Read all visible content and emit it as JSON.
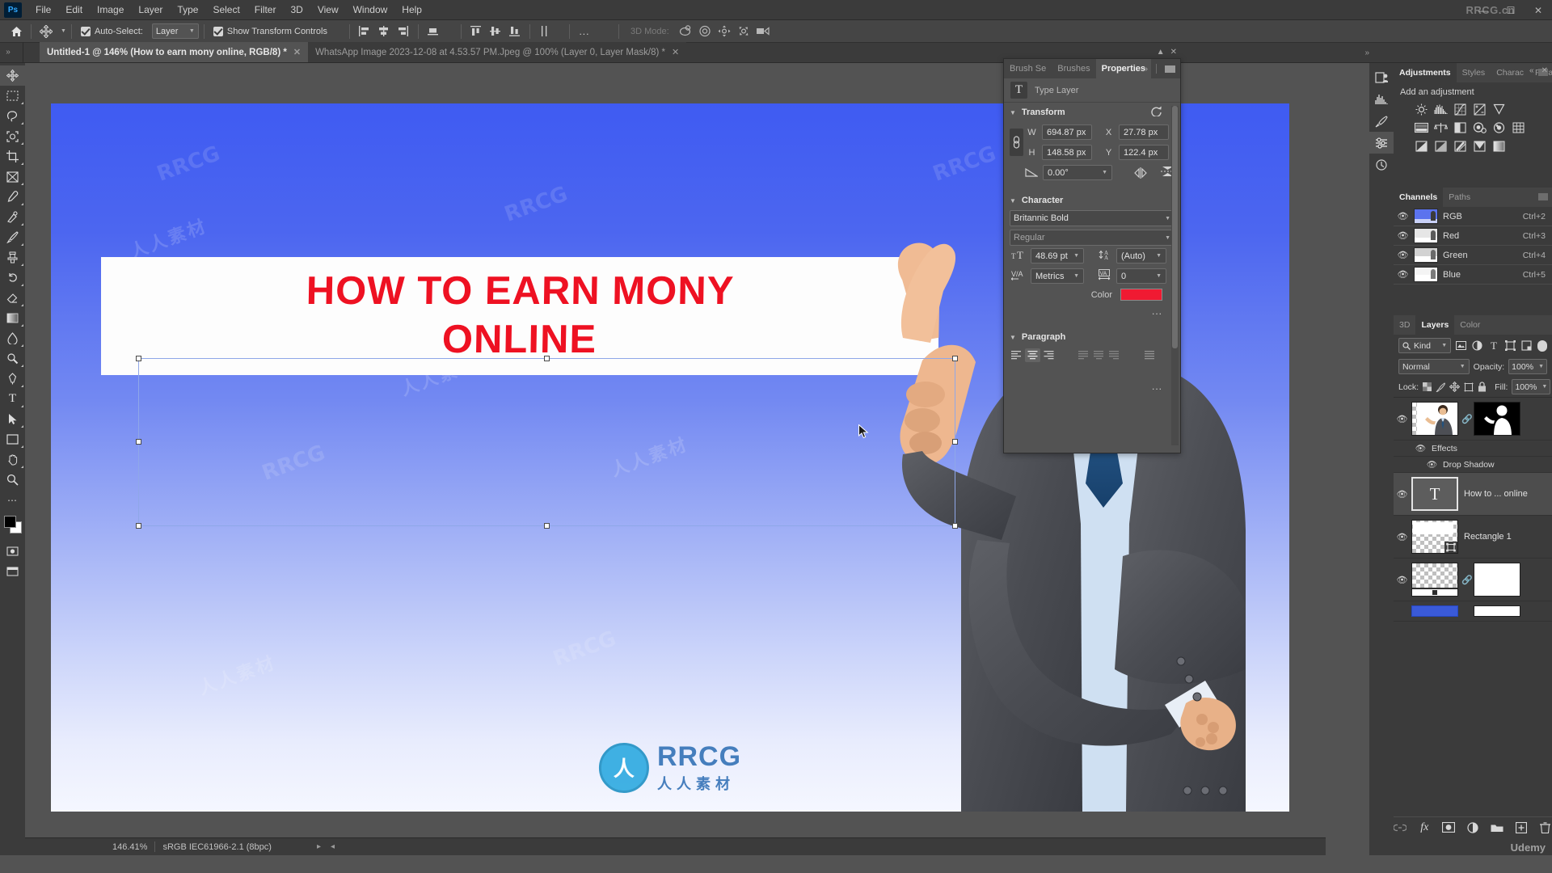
{
  "app": {
    "name": "Adobe Photoshop",
    "logo_text": "Ps",
    "watermark_brand": "RRCG.cn",
    "watermark_text": "RRCG",
    "watermark_cn": "人人素材",
    "udemy": "Udemy"
  },
  "menubar": {
    "items": [
      "File",
      "Edit",
      "Image",
      "Layer",
      "Type",
      "Select",
      "Filter",
      "3D",
      "View",
      "Window",
      "Help"
    ],
    "window_controls": [
      "minimize",
      "maximize",
      "close"
    ]
  },
  "optionsbar": {
    "home_icon": "home-icon",
    "tool_icon": "move-tool-icon",
    "auto_select_label": "Auto-Select:",
    "auto_select_checked": true,
    "auto_select_scope": "Layer",
    "show_transform_label": "Show Transform Controls",
    "show_transform_checked": true,
    "align_icons": [
      "align-left-edges",
      "align-horizontal-centers",
      "align-right-edges",
      "align-bottom-edges"
    ],
    "distribute_icons": [
      "distribute-top-edges",
      "distribute-vertical-centers",
      "distribute-bottom-edges",
      "distribute-horizontal-centers"
    ],
    "more_label": "...",
    "three_d_mode_label": "3D Mode:",
    "three_d_icons": [
      "orbit-3d-icon",
      "roll-3d-icon",
      "pan-3d-icon",
      "slide-3d-icon",
      "camera-3d-icon"
    ]
  },
  "tabs": [
    {
      "title": "Untitled-1 @ 146% (How to earn mony online, RGB/8) *",
      "active": true,
      "closable": true
    },
    {
      "title": "WhatsApp Image 2023-12-08 at 4.53.57 PM.Jpeg @ 100% (Layer 0, Layer Mask/8) *",
      "active": false,
      "closable": true
    }
  ],
  "toolbar": {
    "tools": [
      "move-tool",
      "rectangular-marquee-tool",
      "lasso-tool",
      "object-selection-tool",
      "crop-tool",
      "frame-tool",
      "eyedropper-tool",
      "spot-healing-brush-tool",
      "brush-tool",
      "clone-stamp-tool",
      "history-brush-tool",
      "eraser-tool",
      "gradient-tool",
      "blur-tool",
      "dodge-tool",
      "pen-tool",
      "horizontal-type-tool",
      "path-selection-tool",
      "rectangle-tool",
      "hand-tool",
      "zoom-tool",
      "edit-toolbar"
    ],
    "foreground_color": "#000000",
    "background_color": "#ffffff"
  },
  "canvas": {
    "headline_line1": "HOW TO EARN MONY",
    "headline_line2": "ONLINE",
    "headline_color": "#ee1122",
    "band_color": "#fdfdfd",
    "background_gradient_top": "#3f5bf2",
    "background_gradient_bottom": "#f5f7ff"
  },
  "statusbar": {
    "zoom": "146.41%",
    "color_profile": "sRGB IEC61966-2.1 (8bpc)"
  },
  "properties_panel": {
    "tabs": [
      {
        "label": "Brush Se",
        "active": false
      },
      {
        "label": "Brushes",
        "active": false
      },
      {
        "label": "Properties",
        "active": true
      }
    ],
    "menu_icons": [
      ">>",
      "panel-menu-icon"
    ],
    "layer_type_icon": "type-layer-icon",
    "layer_type_label": "Type Layer",
    "transform": {
      "section_label": "Transform",
      "reset_icon": "reset-icon",
      "link_icon": "link-aspect-ratio-icon",
      "w_label": "W",
      "w_value": "694.87 px",
      "h_label": "H",
      "h_value": "148.58 px",
      "x_label": "X",
      "x_value": "27.78 px",
      "y_label": "Y",
      "y_value": "122.4 px",
      "angle_icon": "rotate-angle-icon",
      "angle_value": "0.00°",
      "flip_h_icon": "flip-horizontal-icon",
      "flip_v_icon": "flip-vertical-icon"
    },
    "character": {
      "section_label": "Character",
      "font_family": "Britannic Bold",
      "font_style": "Regular",
      "size_icon": "font-size-icon",
      "size_value": "48.69 pt",
      "leading_icon": "leading-icon",
      "leading_value": "(Auto)",
      "kerning_icon": "kerning-icon",
      "kerning_value": "Metrics",
      "tracking_icon": "tracking-icon",
      "tracking_value": "0",
      "color_label": "Color",
      "color_value": "#f01a32",
      "more_label": "..."
    },
    "paragraph": {
      "section_label": "Paragraph",
      "align_icons": [
        "align-text-left",
        "align-text-center",
        "align-text-right",
        "justify-last-left",
        "justify-last-center",
        "justify-last-right",
        "justify-all"
      ],
      "active_align": "align-text-center",
      "more_label": "..."
    }
  },
  "dock_strip": {
    "buttons": [
      "libraries-icon",
      "histogram-icon",
      "adjustments-icon",
      "history-icon"
    ]
  },
  "adjustments_panel": {
    "tabs": [
      {
        "label": "Adjustments",
        "active": true
      },
      {
        "label": "Styles",
        "active": false
      },
      {
        "label": "Charac",
        "active": false
      },
      {
        "label": "Paragr",
        "active": false
      }
    ],
    "title": "Add an adjustment",
    "row1": [
      "brightness-contrast-icon",
      "levels-icon",
      "curves-icon",
      "exposure-icon",
      "vibrance-icon"
    ],
    "row2": [
      "hue-saturation-icon",
      "color-balance-icon",
      "black-white-icon",
      "photo-filter-icon",
      "channel-mixer-icon",
      "color-lookup-icon"
    ],
    "row3": [
      "invert-icon",
      "posterize-icon",
      "threshold-icon",
      "selective-color-icon",
      "gradient-map-icon"
    ]
  },
  "channels_panel": {
    "tabs": [
      {
        "label": "Channels",
        "active": true
      },
      {
        "label": "Paths",
        "active": false
      }
    ],
    "rows": [
      {
        "name": "RGB",
        "shortcut": "Ctrl+2",
        "visible": true
      },
      {
        "name": "Red",
        "shortcut": "Ctrl+3",
        "visible": true
      },
      {
        "name": "Green",
        "shortcut": "Ctrl+4",
        "visible": true
      },
      {
        "name": "Blue",
        "shortcut": "Ctrl+5",
        "visible": true
      }
    ]
  },
  "layers_panel": {
    "tabs": [
      {
        "label": "3D",
        "active": false
      },
      {
        "label": "Layers",
        "active": true
      },
      {
        "label": "Color",
        "active": false
      }
    ],
    "filter_label": "Kind",
    "filter_icons": [
      "filter-pixel-icon",
      "filter-adjustment-icon",
      "filter-type-icon",
      "filter-shape-icon",
      "filter-smart-object-icon"
    ],
    "filter_toggle": "filter-enable-toggle",
    "blend_mode": "Normal",
    "opacity_label": "Opacity:",
    "opacity_value": "100%",
    "lock_label": "Lock:",
    "lock_icons": [
      "lock-transparent-pixels-icon",
      "lock-image-pixels-icon",
      "lock-position-icon",
      "lock-artboard-nesting-icon",
      "lock-all-icon"
    ],
    "fill_label": "Fill:",
    "fill_value": "100%",
    "layers": [
      {
        "name": "",
        "visible": true,
        "has_mask": true,
        "selected": false,
        "effects": [
          {
            "label": "Effects",
            "visible": true
          },
          {
            "label": "Drop Shadow",
            "visible": true
          }
        ]
      },
      {
        "name": "How to ... online",
        "visible": true,
        "has_mask": false,
        "selected": true,
        "type": "text"
      },
      {
        "name": "Rectangle 1",
        "visible": true,
        "has_mask": false,
        "selected": false,
        "type": "shape"
      },
      {
        "name": "",
        "visible": true,
        "has_mask": true,
        "selected": false,
        "type": "pixel"
      }
    ],
    "bottom_icons": [
      "link-layers-icon",
      "layer-style-fx-icon",
      "add-layer-mask-icon",
      "new-adjustment-layer-icon",
      "new-group-icon",
      "new-layer-icon",
      "delete-layer-icon"
    ]
  }
}
